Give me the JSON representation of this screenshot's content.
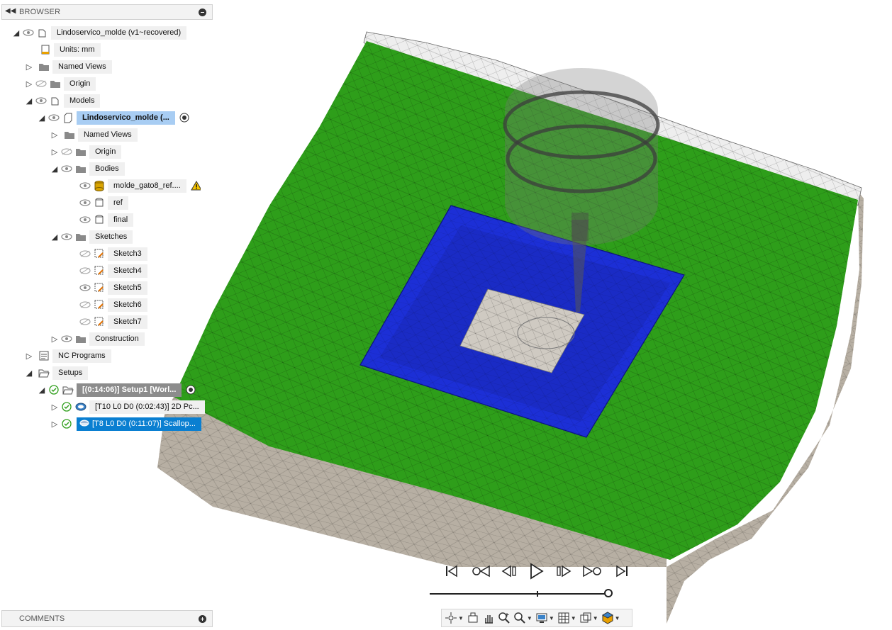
{
  "browser": {
    "title": "BROWSER",
    "items": [
      {
        "label": "Lindoservico_molde (v1~recovered)"
      },
      {
        "label": "Units: mm"
      },
      {
        "label": "Named Views"
      },
      {
        "label": "Origin"
      },
      {
        "label": "Models"
      },
      {
        "label": "Lindoservico_molde (..."
      },
      {
        "label": "Named Views"
      },
      {
        "label": "Origin"
      },
      {
        "label": "Bodies"
      },
      {
        "label": "molde_gato8_ref...."
      },
      {
        "label": "ref"
      },
      {
        "label": "final"
      },
      {
        "label": "Sketches"
      },
      {
        "label": "Sketch3"
      },
      {
        "label": "Sketch4"
      },
      {
        "label": "Sketch5"
      },
      {
        "label": "Sketch6"
      },
      {
        "label": "Sketch7"
      },
      {
        "label": "Construction"
      },
      {
        "label": "NC Programs"
      },
      {
        "label": "Setups"
      },
      {
        "label": "[(0:14:06)] Setup1 [Worl..."
      },
      {
        "label": "[T10 L0 D0 (0:02:43)] 2D Pc..."
      },
      {
        "label": "[T8 L0 D0 (0:11:07)] Scallop..."
      }
    ]
  },
  "comments": {
    "title": "COMMENTS"
  },
  "playback": {
    "buttons": [
      "go-to-start",
      "previous-operation",
      "step-back",
      "play",
      "step-forward",
      "next-operation",
      "go-to-end"
    ],
    "progress": 1.0
  },
  "navbar": {
    "icons": [
      "orbit-icon",
      "look-at-icon",
      "pan-icon",
      "zoom-window-icon",
      "zoom-icon",
      "display-settings-icon",
      "grid-icon",
      "viewports-icon",
      "environment-icon"
    ]
  },
  "colors": {
    "stock_top": "#2e9e1a",
    "pocket": "#1c2fd6",
    "model_grey": "#b4aca0",
    "selection": "#a8cdf3",
    "active_op": "#0a7fd1"
  }
}
